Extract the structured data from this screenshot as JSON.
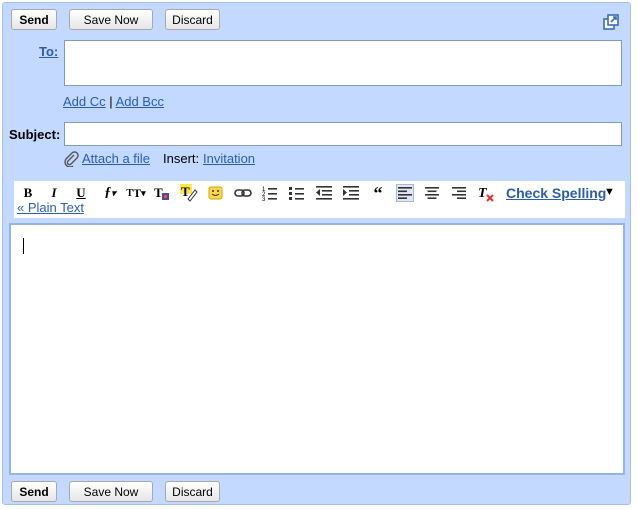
{
  "top_buttons": {
    "send": "Send",
    "save_now": "Save Now",
    "discard": "Discard"
  },
  "bottom_buttons": {
    "send": "Send",
    "save_now": "Save Now",
    "discard": "Discard"
  },
  "to": {
    "label": "To:",
    "value": ""
  },
  "links": {
    "add_cc": "Add Cc",
    "separator": "|",
    "add_bcc": "Add Bcc"
  },
  "subject": {
    "label": "Subject:",
    "value": ""
  },
  "attach": {
    "label": "Attach a file",
    "insert_label": "Insert:",
    "invitation": "Invitation"
  },
  "toolbar": {
    "items": [
      "bold-icon",
      "italic-icon",
      "underline-icon",
      "font-icon",
      "font-size-icon",
      "text-color-icon",
      "highlight-icon",
      "emoticon-icon",
      "link-icon",
      "numbered-list-icon",
      "bulleted-list-icon",
      "outdent-icon",
      "indent-icon",
      "quote-icon",
      "align-left-icon",
      "align-center-icon",
      "align-right-icon",
      "remove-formatting-icon"
    ],
    "check_spelling": "Check Spelling",
    "plain_text": "« Plain Text"
  },
  "body": {
    "value": ""
  },
  "colors": {
    "frame": "#c3d9ff",
    "link": "#2a5db0",
    "border": "#98b4e0"
  }
}
